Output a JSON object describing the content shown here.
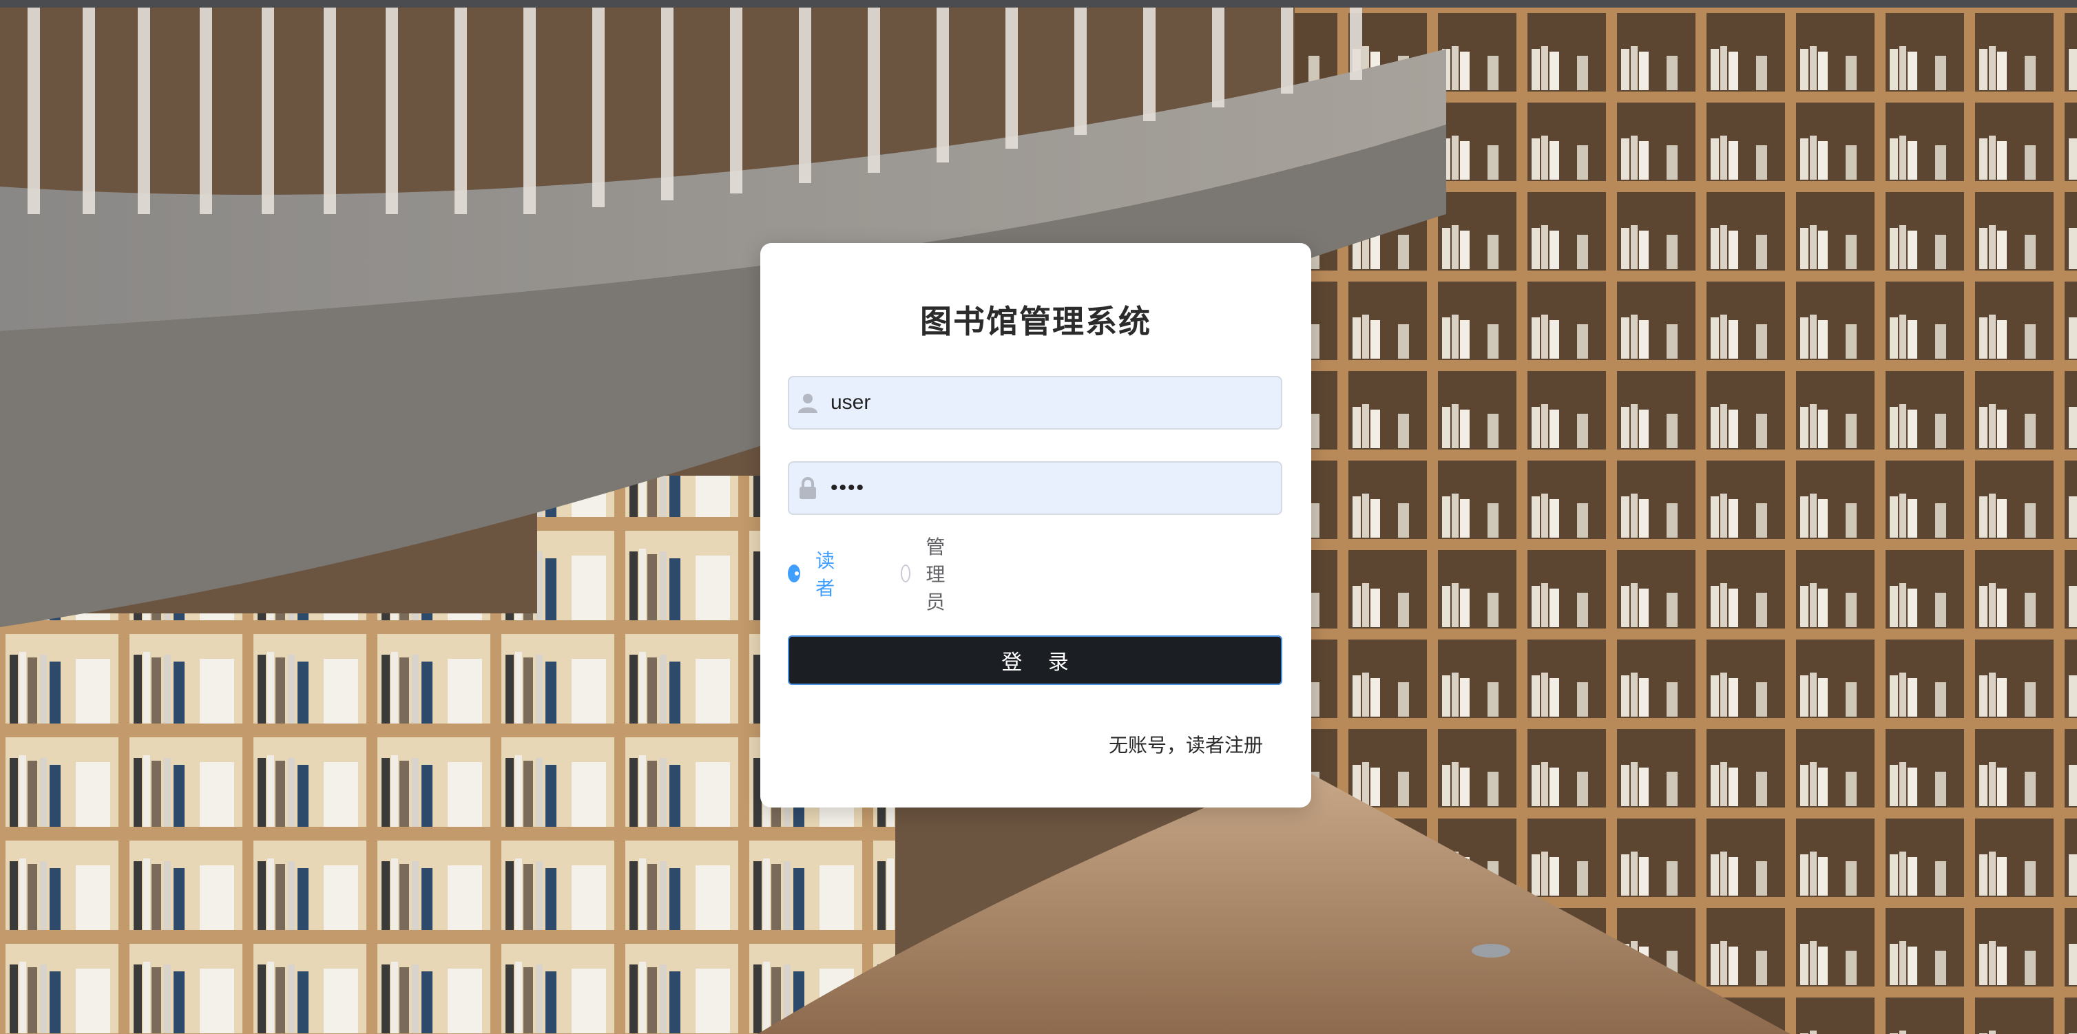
{
  "login": {
    "title": "图书馆管理系统",
    "username_value": "user",
    "password_value": "••••",
    "username_icon": "user-icon",
    "password_icon": "lock-icon",
    "roles": [
      {
        "label": "读者",
        "selected": true
      },
      {
        "label": "管理员",
        "selected": false
      }
    ],
    "submit_label": "登 录",
    "register_link": "无账号，读者注册"
  },
  "colors": {
    "accent": "#409eff",
    "button_bg": "#1b1f24",
    "input_bg": "#e8f0fe"
  },
  "background": "library-bookshelves-photo"
}
